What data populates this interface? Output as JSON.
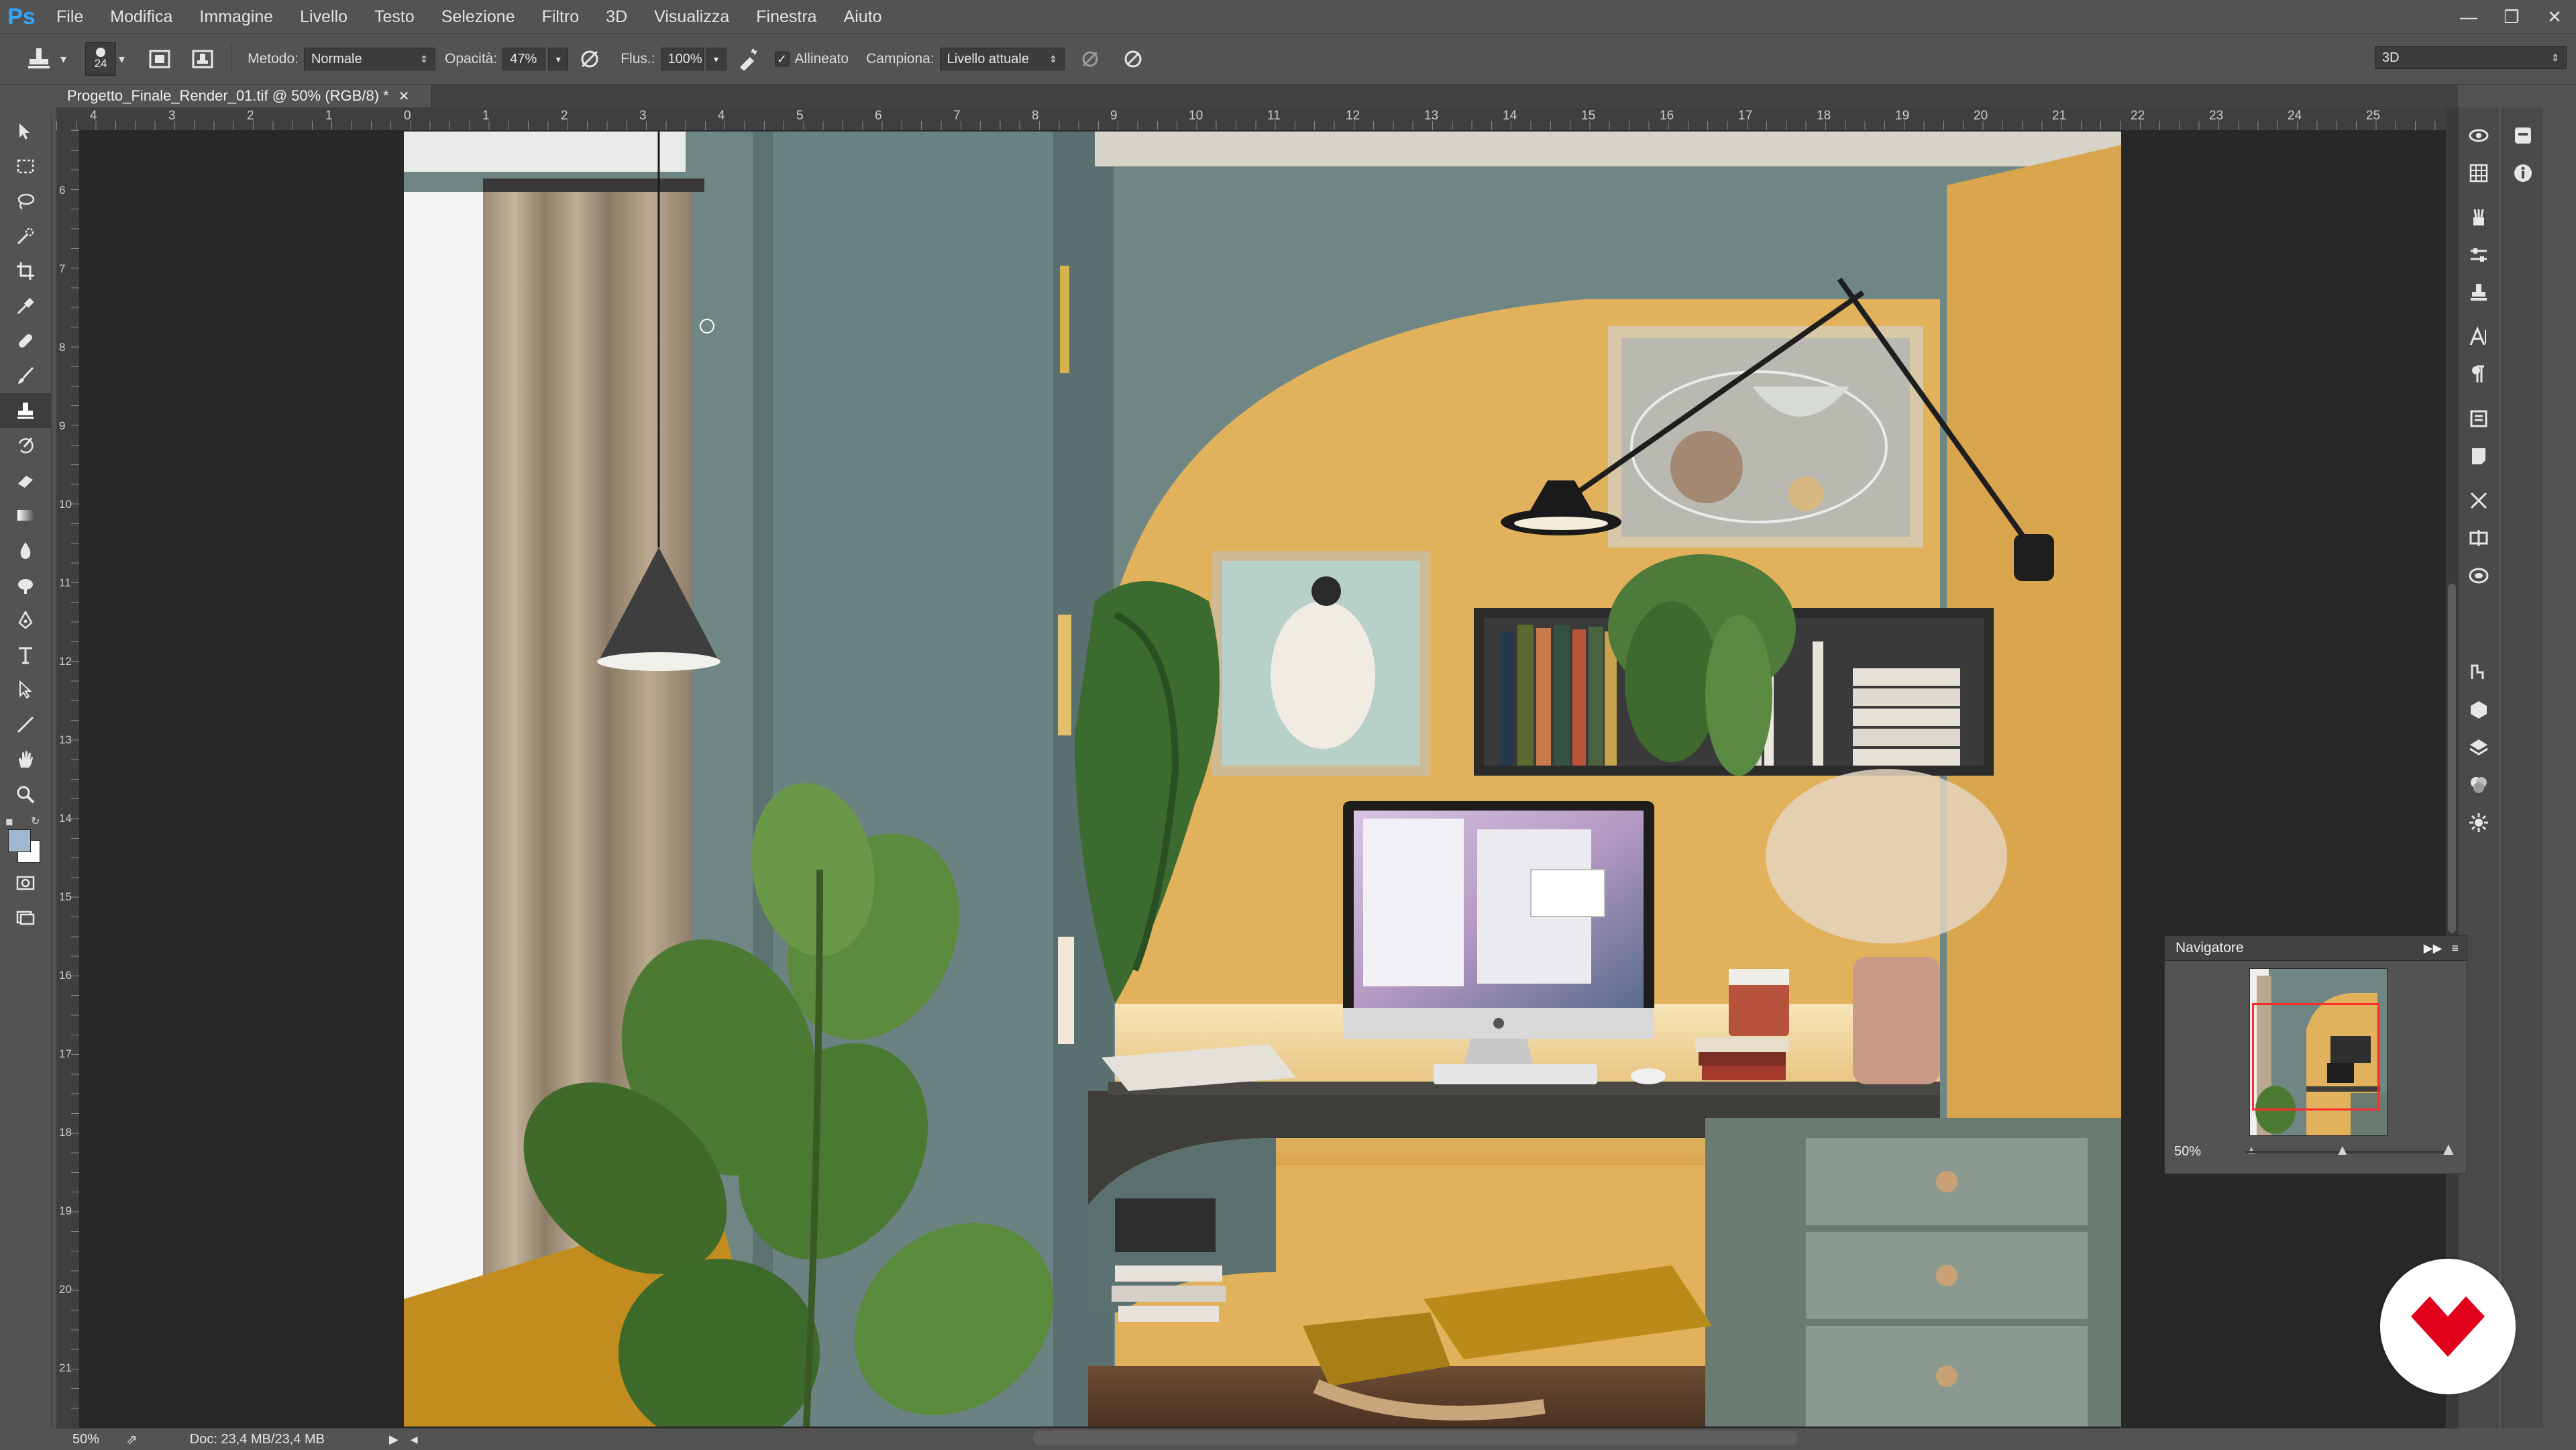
{
  "app": {
    "logo": "Ps"
  },
  "menu": {
    "items": [
      "File",
      "Modifica",
      "Immagine",
      "Livello",
      "Testo",
      "Selezione",
      "Filtro",
      "3D",
      "Visualizza",
      "Finestra",
      "Aiuto"
    ]
  },
  "options": {
    "brush_size": "24",
    "method_label": "Metodo:",
    "method_value": "Normale",
    "opacity_label": "Opacità:",
    "opacity_value": "47%",
    "flow_label": "Flus.:",
    "flow_value": "100%",
    "aligned_label": "Allineato",
    "sample_label": "Campiona:",
    "sample_value": "Livello attuale",
    "workspace_value": "3D"
  },
  "document": {
    "tab_title": "Progetto_Finale_Render_01.tif @ 50% (RGB/8) *"
  },
  "ruler": {
    "top_labels": [
      "4",
      "3",
      "2",
      "1",
      "0",
      "1",
      "2",
      "3",
      "4",
      "5",
      "6",
      "7",
      "8",
      "9",
      "10",
      "11",
      "12",
      "13",
      "14",
      "15",
      "16",
      "17",
      "18",
      "19",
      "20",
      "21",
      "22",
      "23",
      "24",
      "25"
    ],
    "left_labels": [
      "6",
      "7",
      "8",
      "9",
      "10",
      "11",
      "12",
      "13",
      "14",
      "15",
      "16",
      "17",
      "18",
      "19",
      "20",
      "21"
    ]
  },
  "navigator": {
    "title": "Navigatore",
    "zoom": "50%"
  },
  "status": {
    "zoom": "50%",
    "doc": "Doc: 23,4 MB/23,4 MB"
  },
  "colors": {
    "accent_blue": "#31a8ff",
    "nav_frame": "#ff2b2b",
    "badge_red": "#e3001b",
    "wall_teal": "#6f8685",
    "wall_yellow": "#e1b25b"
  },
  "icons": {
    "tools": [
      "move-icon",
      "marquee-icon",
      "lasso-icon",
      "quick-select-icon",
      "crop-icon",
      "eyedropper-icon",
      "healing-icon",
      "brush-icon",
      "clone-stamp-icon",
      "history-brush-icon",
      "eraser-icon",
      "gradient-icon",
      "blur-icon",
      "dodge-icon",
      "pen-icon",
      "type-icon",
      "path-select-icon",
      "line-icon",
      "hand-icon",
      "zoom-icon"
    ]
  }
}
